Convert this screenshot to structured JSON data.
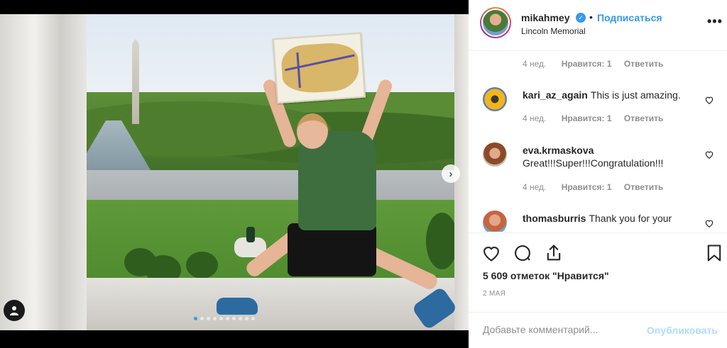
{
  "post": {
    "username": "mikahmey",
    "follow_label": "Подписаться",
    "separator": "•",
    "location": "Lincoln Memorial",
    "more_label": "•••"
  },
  "comments": [
    {
      "time": "4 нед.",
      "likes": "Нравится: 1",
      "reply": "Ответить"
    },
    {
      "user": "kari_az_again",
      "text": "This is just amazing.",
      "time": "4 нед.",
      "likes": "Нравится: 1",
      "reply": "Ответить"
    },
    {
      "user": "eva.krmaskova",
      "text": "Great!!!Super!!!Congratulation!!!",
      "time": "4 нед.",
      "likes": "Нравится: 1",
      "reply": "Ответить"
    },
    {
      "user": "thomasburris",
      "text": "Thank you for your"
    }
  ],
  "actions": {
    "likes_count": "5 609 отметок \"Нравится\"",
    "date": "2 МАЯ"
  },
  "comment_box": {
    "placeholder": "Добавьте комментарий...",
    "publish_label": "Опубликовать"
  },
  "icons": {
    "like": "heart-icon",
    "comment": "comment-icon",
    "share": "share-icon",
    "save": "bookmark-icon",
    "next": "chevron-right-icon",
    "tag": "user-tag-icon",
    "verified": "verified-badge-icon"
  },
  "carousel": {
    "slides": 10,
    "active_index": 0
  },
  "colors": {
    "link": "#3897f0",
    "muted": "#8e8e8e",
    "text": "#262626",
    "publish_disabled": "#b3dbff"
  }
}
